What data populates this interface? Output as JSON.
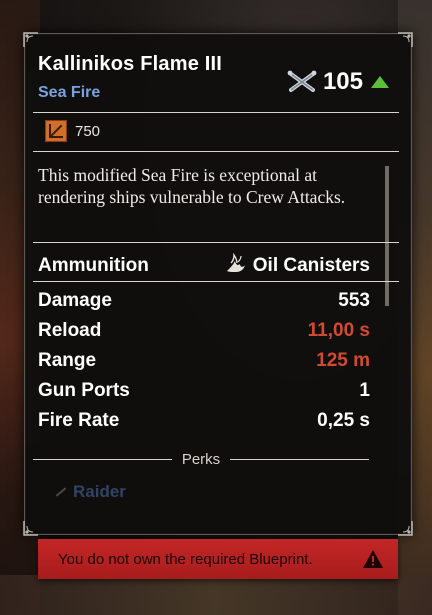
{
  "item": {
    "name": "Kallinikos Flame III",
    "type": "Sea Fire",
    "power": "105",
    "cost": "750",
    "description": "This modified Sea Fire is exceptional at rendering ships vulnerable to Crew Attacks."
  },
  "stats": {
    "ammunition_label": "Ammunition",
    "ammunition_value": "Oil Canisters",
    "rows": [
      {
        "label": "Damage",
        "value": "553"
      },
      {
        "label": "Reload",
        "value": "11,00 s"
      },
      {
        "label": "Range",
        "value": "125 m"
      },
      {
        "label": "Gun Ports",
        "value": "1"
      },
      {
        "label": "Fire Rate",
        "value": "0,25 s"
      }
    ]
  },
  "perks": {
    "header": "Perks",
    "first_faded": "Raider"
  },
  "warning": {
    "text": "You do not own the required Blueprint."
  },
  "colors": {
    "subtitle": "#7aa2e0",
    "negative_stat": "#d24a32",
    "upgrade_arrow": "#5bbf3a",
    "warning_bg": "#b42020"
  }
}
